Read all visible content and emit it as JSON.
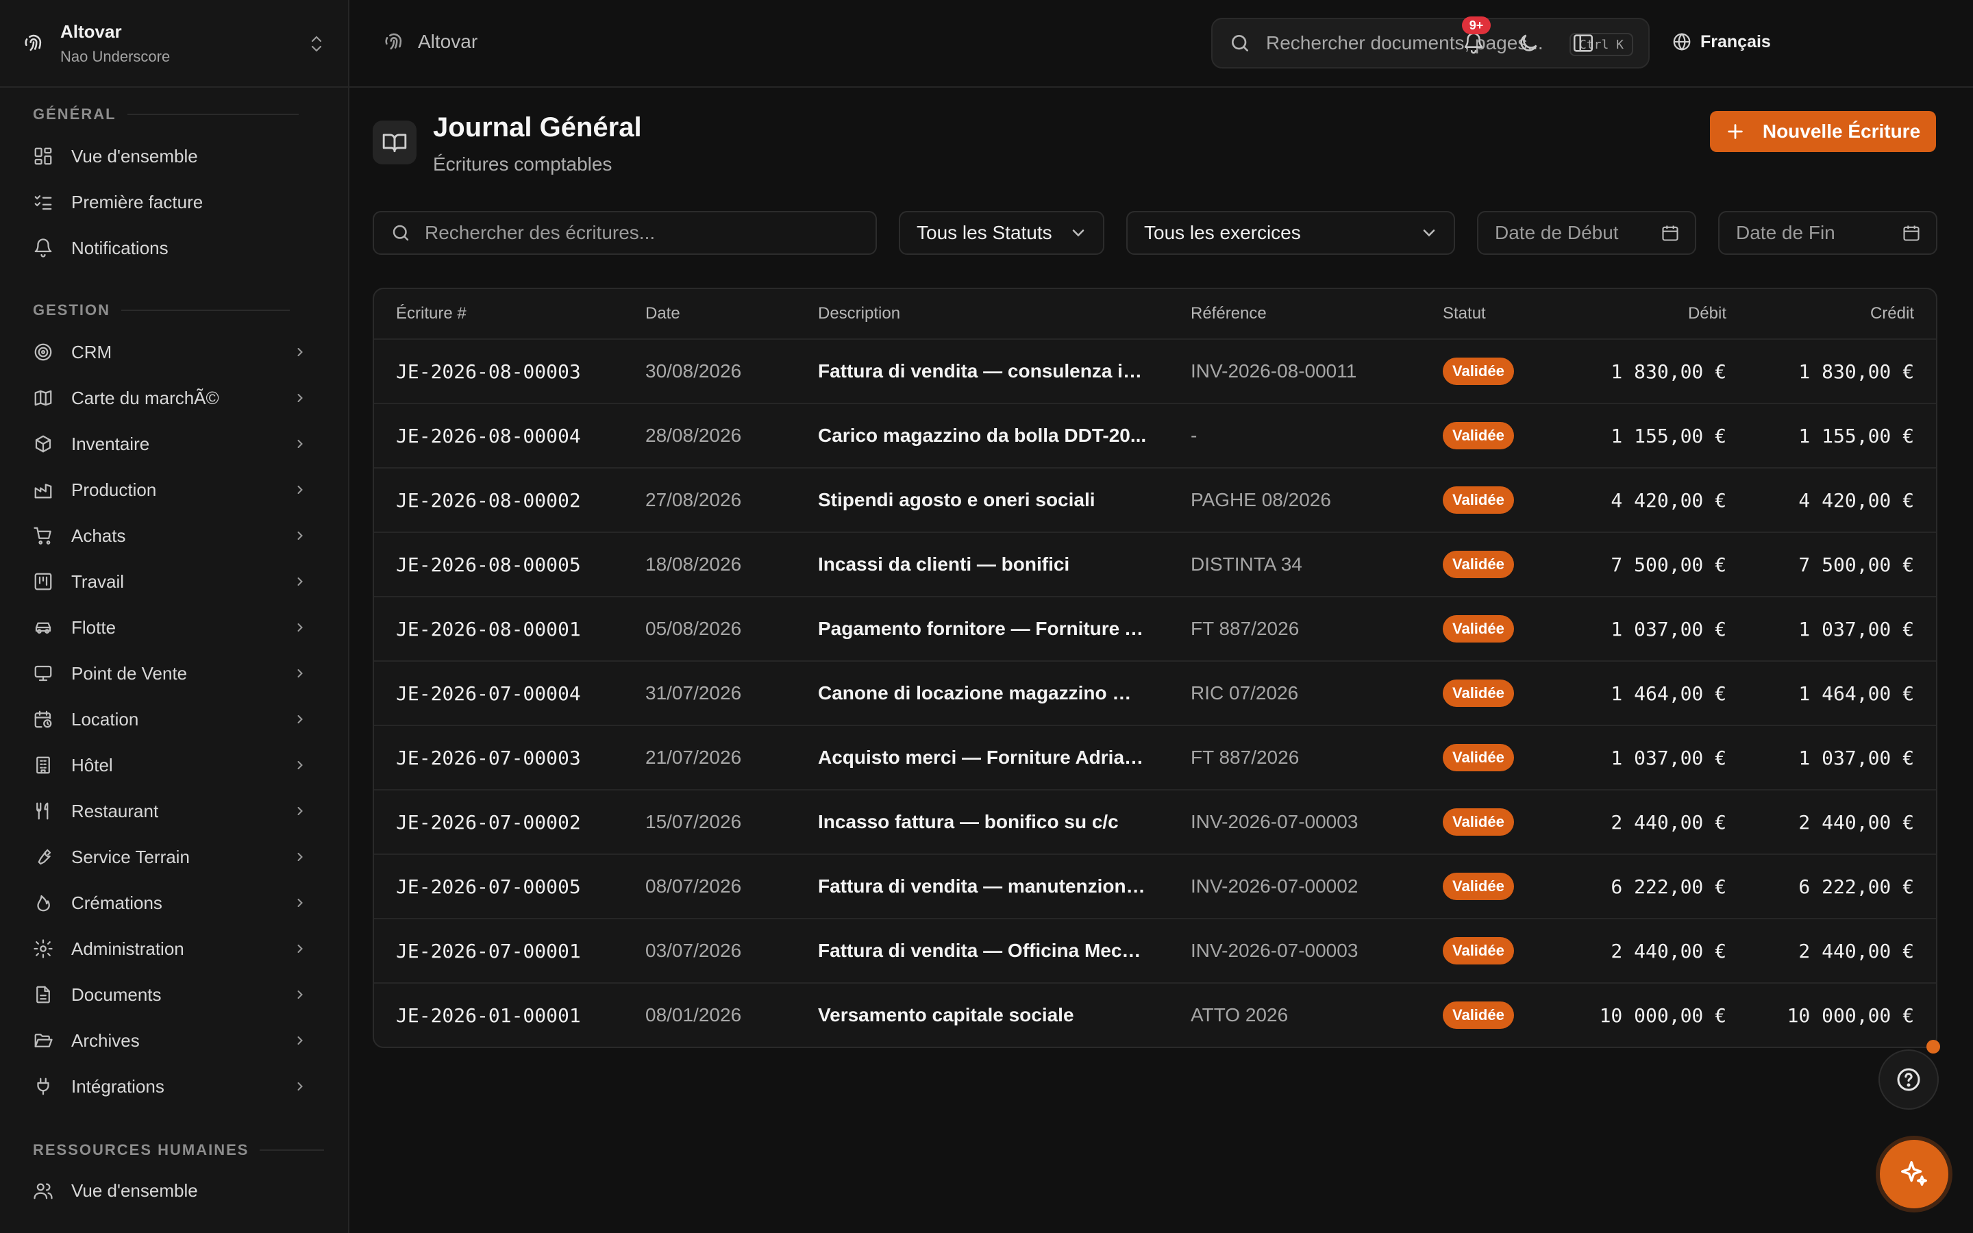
{
  "org": {
    "name": "Altovar",
    "subtitle": "Nao Underscore"
  },
  "sidebar": {
    "sections": {
      "general": "GÉNÉRAL",
      "gestion": "GESTION",
      "rh": "RESSOURCES HUMAINES"
    },
    "general_items": [
      {
        "label": "Vue d'ensemble",
        "icon": "dashboard-icon"
      },
      {
        "label": "Première facture",
        "icon": "checklist-icon"
      },
      {
        "label": "Notifications",
        "icon": "bell-icon"
      }
    ],
    "gestion_items": [
      {
        "label": "CRM",
        "icon": "target-icon"
      },
      {
        "label": "Carte du marchÃ©",
        "icon": "map-icon"
      },
      {
        "label": "Inventaire",
        "icon": "package-icon"
      },
      {
        "label": "Production",
        "icon": "factory-icon"
      },
      {
        "label": "Achats",
        "icon": "cart-icon"
      },
      {
        "label": "Travail",
        "icon": "kanban-icon"
      },
      {
        "label": "Flotte",
        "icon": "car-icon"
      },
      {
        "label": "Point de Vente",
        "icon": "monitor-icon"
      },
      {
        "label": "Location",
        "icon": "calendar-clock-icon"
      },
      {
        "label": "Hôtel",
        "icon": "building-icon"
      },
      {
        "label": "Restaurant",
        "icon": "utensils-icon"
      },
      {
        "label": "Service Terrain",
        "icon": "wrench-icon"
      },
      {
        "label": "Crémations",
        "icon": "flame-icon"
      },
      {
        "label": "Administration",
        "icon": "gear-icon"
      },
      {
        "label": "Documents",
        "icon": "document-icon"
      },
      {
        "label": "Archives",
        "icon": "folder-open-icon"
      },
      {
        "label": "Intégrations",
        "icon": "plug-icon"
      }
    ],
    "rh_items": [
      {
        "label": "Vue d'ensemble",
        "icon": "users-icon"
      }
    ]
  },
  "topbar": {
    "breadcrumb": "Altovar",
    "search_placeholder": "Rechercher documents, pages...",
    "search_shortcut": "Ctrl K",
    "language": "Français",
    "notifications_badge": "9+"
  },
  "page": {
    "title": "Journal Général",
    "subtitle": "Écritures comptables",
    "new_button": "Nouvelle Écriture"
  },
  "filters": {
    "search_placeholder": "Rechercher des écritures...",
    "status": "Tous les Statuts",
    "fiscal_year": "Tous les exercices",
    "start_date_placeholder": "Date de Début",
    "end_date_placeholder": "Date de Fin"
  },
  "table": {
    "columns": [
      "Écriture #",
      "Date",
      "Description",
      "Référence",
      "Statut",
      "Débit",
      "Crédit"
    ],
    "rows": [
      {
        "id": "JE-2026-08-00003",
        "date": "30/08/2026",
        "description": "Fattura di vendita — consulenza im...",
        "reference": "INV-2026-08-00011",
        "status": "Validée",
        "debit": "1 830,00 €",
        "credit": "1 830,00 €"
      },
      {
        "id": "JE-2026-08-00004",
        "date": "28/08/2026",
        "description": "Carico magazzino da bolla DDT-20...",
        "reference": "-",
        "status": "Validée",
        "debit": "1 155,00 €",
        "credit": "1 155,00 €"
      },
      {
        "id": "JE-2026-08-00002",
        "date": "27/08/2026",
        "description": "Stipendi agosto e oneri sociali",
        "reference": "PAGHE 08/2026",
        "status": "Validée",
        "debit": "4 420,00 €",
        "credit": "4 420,00 €"
      },
      {
        "id": "JE-2026-08-00005",
        "date": "18/08/2026",
        "description": "Incassi da clienti — bonifici",
        "reference": "DISTINTA 34",
        "status": "Validée",
        "debit": "7 500,00 €",
        "credit": "7 500,00 €"
      },
      {
        "id": "JE-2026-08-00001",
        "date": "05/08/2026",
        "description": "Pagamento fornitore — Forniture A...",
        "reference": "FT 887/2026",
        "status": "Validée",
        "debit": "1 037,00 €",
        "credit": "1 037,00 €"
      },
      {
        "id": "JE-2026-07-00004",
        "date": "31/07/2026",
        "description": "Canone di locazione magazzino — l...",
        "reference": "RIC 07/2026",
        "status": "Validée",
        "debit": "1 464,00 €",
        "credit": "1 464,00 €"
      },
      {
        "id": "JE-2026-07-00003",
        "date": "21/07/2026",
        "description": "Acquisto merci — Forniture Adriatica",
        "reference": "FT 887/2026",
        "status": "Validée",
        "debit": "1 037,00 €",
        "credit": "1 037,00 €"
      },
      {
        "id": "JE-2026-07-00002",
        "date": "15/07/2026",
        "description": "Incasso fattura — bonifico su c/c",
        "reference": "INV-2026-07-00003",
        "status": "Validée",
        "debit": "2 440,00 €",
        "credit": "2 440,00 €"
      },
      {
        "id": "JE-2026-07-00005",
        "date": "08/07/2026",
        "description": "Fattura di vendita — manutenzione ...",
        "reference": "INV-2026-07-00002",
        "status": "Validée",
        "debit": "6 222,00 €",
        "credit": "6 222,00 €"
      },
      {
        "id": "JE-2026-07-00001",
        "date": "03/07/2026",
        "description": "Fattura di vendita — Officina Mecca...",
        "reference": "INV-2026-07-00003",
        "status": "Validée",
        "debit": "2 440,00 €",
        "credit": "2 440,00 €"
      },
      {
        "id": "JE-2026-01-00001",
        "date": "08/01/2026",
        "description": "Versamento capitale sociale",
        "reference": "ATTO 2026",
        "status": "Validée",
        "debit": "10 000,00 €",
        "credit": "10 000,00 €"
      }
    ]
  },
  "colors": {
    "accent": "#d95f15",
    "background": "#111111",
    "badge": "#e0313b"
  }
}
